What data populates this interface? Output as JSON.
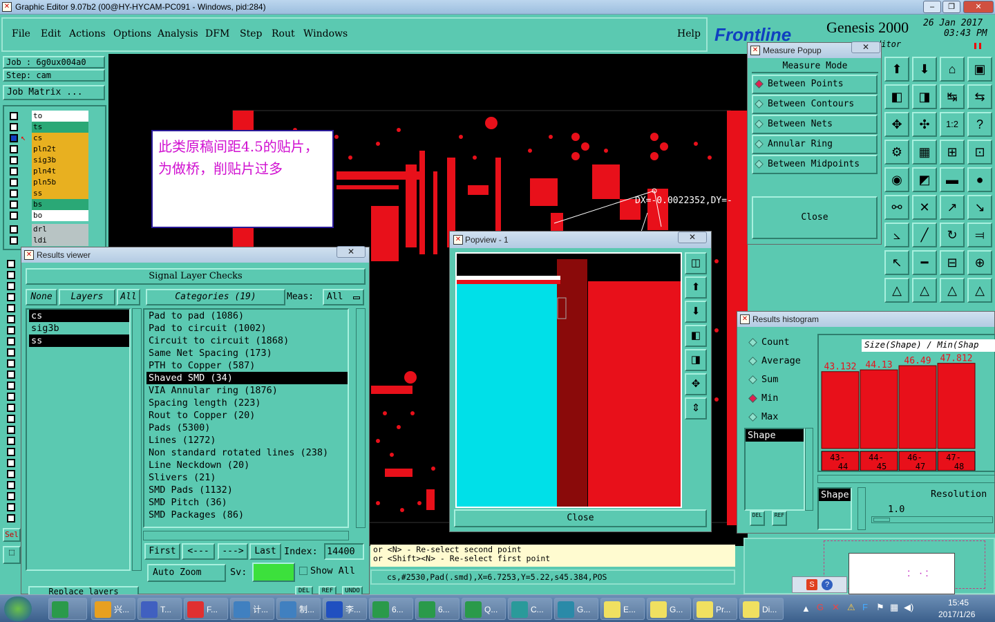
{
  "window": {
    "title": "Graphic Editor 9.07b2 (00@HY-HYCAM-PC091 - Windows, pid:284)",
    "min": "–",
    "max": "❐",
    "close": "✕"
  },
  "menu": [
    "File",
    "Edit",
    "Actions",
    "Options",
    "Analysis",
    "DFM",
    "Step",
    "Rout",
    "Windows"
  ],
  "help": "Help",
  "brand": {
    "logo": "Frontline",
    "product": "Genesis 2000",
    "date": "26 Jan 2017",
    "time": "03:43 PM",
    "sub": "ditor"
  },
  "job": {
    "job": "Job : 6g0ux004a0",
    "step": "Step: cam",
    "matrix": "Job Matrix ..."
  },
  "layers": [
    {
      "name": "to",
      "color": "#ffffff",
      "mark": "⬥"
    },
    {
      "name": "ts",
      "color": "#2aa876",
      "mark": ""
    },
    {
      "name": "cs",
      "color": "#e8b020",
      "mark": "⬥⊞"
    },
    {
      "name": "pln2t",
      "color": "#e8b020",
      "mark": ""
    },
    {
      "name": "sig3b",
      "color": "#e8b020",
      "mark": "⬥"
    },
    {
      "name": "pln4t",
      "color": "#e8b020",
      "mark": ""
    },
    {
      "name": "pln5b",
      "color": "#e8b020",
      "mark": ""
    },
    {
      "name": "ss",
      "color": "#e8b020",
      "mark": "⬥"
    },
    {
      "name": "bs",
      "color": "#2aa876",
      "mark": ""
    },
    {
      "name": "bo",
      "color": "#ffffff",
      "mark": ""
    },
    {
      "name": "drl",
      "color": "#b8c4c4",
      "mark": ""
    },
    {
      "name": "ldi",
      "color": "#b8c4c4",
      "mark": ""
    }
  ],
  "sel_label": "Sel",
  "annotation": "此类原稿间距4.5的贴片，为做桥，削贴片过多",
  "dx_readout": "DX=-0.0022352,DY=-",
  "results_viewer": {
    "title": "Results viewer",
    "header": "Signal Layer Checks",
    "none": "None",
    "layers_btn": "Layers",
    "all": "All",
    "categories_btn": "Categories (19)",
    "meas_label": "Meas:",
    "meas_value": "All",
    "layers": [
      "cs",
      "sig3b",
      "ss"
    ],
    "categories": [
      "Pad to pad (1086)",
      "Pad to circuit (1002)",
      "Circuit to circuit (1868)",
      "Same Net Spacing (173)",
      "PTH to Copper (587)",
      "Shaved SMD (34)",
      "VIA Annular ring (1876)",
      "Spacing length (223)",
      "Rout to Copper (20)",
      "Pads (5300)",
      "Lines (1272)",
      "Non standard rotated lines (238)",
      "Line Neckdown (20)",
      "Slivers (21)",
      "SMD Pads (1132)",
      "SMD Pitch (36)",
      "SMD Packages (86)"
    ],
    "first": "First",
    "prev": "<---",
    "next": "--->",
    "last": "Last",
    "index_label": "Index:",
    "index_value": "14400",
    "auto_zoom": "Auto Zoom",
    "sv": "Sv:",
    "show_all": "Show All",
    "replace": "Replace layers",
    "del": "DEL",
    "ref": "REF",
    "undo": "UNDO"
  },
  "measure_popup": {
    "title": "Measure Popup",
    "mode_header": "Measure Mode",
    "modes": [
      "Between Points",
      "Between Contours",
      "Between Nets",
      "Annular Ring",
      "Between Midpoints"
    ],
    "selected": "Between Points",
    "close": "Close"
  },
  "popview": {
    "title": "Popview - 1",
    "close": "Close"
  },
  "histogram": {
    "title": "Results histogram",
    "options": [
      "Count",
      "Average",
      "Sum",
      "Min",
      "Max"
    ],
    "selected": "Min",
    "shape": "Shape",
    "chart_title": "Size(Shape) / Min(Shap",
    "resolution_label": "Resolution",
    "resolution_value": "1.0",
    "del": "DEL",
    "ref": "REF"
  },
  "chart_data": {
    "type": "bar",
    "title": "Size(Shape) / Min(Shap",
    "categories": [
      "43-44",
      "44-45",
      "46-47",
      "47-48"
    ],
    "values": [
      43.132,
      44.13,
      46.49,
      47.812
    ],
    "ylim": [
      0,
      50
    ]
  },
  "status": {
    "line1": "or <N> - Re-select second point",
    "line2": "or <Shift><N> - Re-select first point",
    "coords": "cs,#2530,Pad(.smd),X=6.7253,Y=5.22,s45.384,POS"
  },
  "taskbar": {
    "items": [
      "兴...",
      "T...",
      "F...",
      "计...",
      "制...",
      "李...",
      "6...",
      "6...",
      "Q...",
      "C...",
      "G...",
      "E...",
      "G...",
      "Pr...",
      "Di..."
    ],
    "time": "15:45",
    "date": "2017/1/26"
  }
}
